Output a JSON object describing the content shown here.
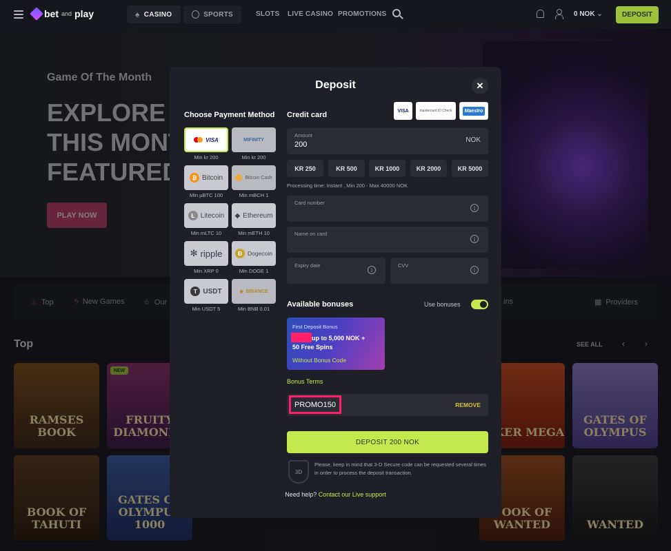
{
  "brand": {
    "name_a": "bet",
    "name_and": "and",
    "name_b": "play"
  },
  "nav": {
    "casino": "CASINO",
    "sports": "SPORTS",
    "slots": "SLOTS",
    "live_casino": "LIVE CASINO",
    "promotions": "PROMOTIONS",
    "balance": "0 NOK",
    "deposit": "DEPOSIT"
  },
  "hero": {
    "subtitle": "Game Of The Month",
    "title_lines": [
      "EXPLORE",
      "THIS MONTH",
      "FEATURED"
    ],
    "cta": "PLAY NOW"
  },
  "categories": [
    "Top",
    "New Games",
    "Our",
    "ins",
    "Providers"
  ],
  "section": {
    "title": "Top",
    "see_all": "SEE ALL"
  },
  "badges": {
    "new": "NEW"
  },
  "tiles": [
    "RAMSES BOOK",
    "FRUITY DIAMONDS",
    "JOKER MEGA",
    "GATES OF OLYMPUS",
    "BOOK OF TAHUTI",
    "GATES OF OLYMPUS 1000",
    "BOOK OF WANTED",
    "WANTED"
  ],
  "modal": {
    "title": "Deposit",
    "payment_method_title": "Choose Payment Method",
    "methods": [
      {
        "label": "VISA",
        "min": "Min kr 200",
        "selected": true
      },
      {
        "label": "MIFINITY",
        "min": "Min kr 200"
      },
      {
        "label": "Bitcoin",
        "min": "Min µBTC 100"
      },
      {
        "label": "Bitcoin Cash",
        "min": "Min mBCH 1"
      },
      {
        "label": "Litecoin",
        "min": "Min mLTC 10"
      },
      {
        "label": "Ethereum",
        "min": "Min mETH 10"
      },
      {
        "label": "ripple",
        "min": "Min XRP 0"
      },
      {
        "label": "Dogecoin",
        "min": "Min DOGE 1"
      },
      {
        "label": "USDT",
        "min": "Min USDT 5"
      },
      {
        "label": "BINANCE",
        "min": "Min BNB 0.01"
      }
    ],
    "credit_card_title": "Credit card",
    "card_logos": [
      "VISA",
      "mastercard ID Check",
      "Maestro"
    ],
    "amount_label": "Amount",
    "amount_value": "200",
    "currency": "NOK",
    "quick_amounts": [
      "KR 250",
      "KR 500",
      "KR 1000",
      "KR 2000",
      "KR 5000"
    ],
    "processing": "Processing time: Instant , Min 200 - Max 40000 NOK",
    "card_number_label": "Card number",
    "name_on_card_label": "Name on card",
    "expiry_label": "Expiry date",
    "cvv_label": "CVV",
    "bonuses_title": "Available bonuses",
    "use_bonuses": "Use bonuses",
    "use_bonuses_on": true,
    "bonus_card": {
      "small": "First Deposit Bonus",
      "line1": "up to 5,000 NOK +",
      "line2": "50 Free Spins",
      "code": "Without Bonus Code"
    },
    "bonus_terms": "Bonus Terms",
    "promo_code": "PROMO150",
    "remove": "REMOVE",
    "deposit_button": "DEPOSIT 200 NOK",
    "secure_badge": "3D",
    "secure_note": "Please, keep in mind that 3-D Secure code can be requested several times in order to process the deposit transaction.",
    "help_text": "Need help?",
    "help_link": "Contact our Live support"
  },
  "colors": {
    "accent": "#c5e84e",
    "highlight": "#ff1f6a",
    "modal_bg": "#1f2027",
    "page_bg": "#16171c"
  }
}
